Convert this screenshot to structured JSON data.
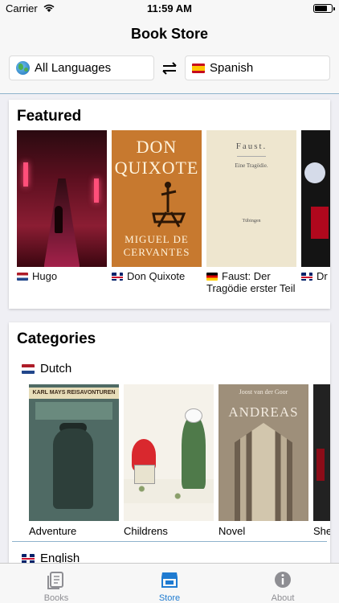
{
  "status_bar": {
    "carrier": "Carrier",
    "time": "11:59 AM",
    "battery_level": 0.75
  },
  "nav": {
    "title": "Book Store"
  },
  "language_selector": {
    "from": {
      "label": "All Languages",
      "icon": "globe-icon"
    },
    "swap_icon": "swap-arrows-icon",
    "to": {
      "label": "Spanish",
      "flag": "spain-flag"
    }
  },
  "featured": {
    "title": "Featured",
    "books": [
      {
        "caption": "Hugo",
        "flag": "netherlands-flag"
      },
      {
        "caption": "Don Quixote",
        "flag": "uk-flag",
        "cover_title": "DON QUIXOTE",
        "cover_author": "MIGUEL DE CERVANTES"
      },
      {
        "caption": "Faust: Der Tragödie erster Teil",
        "flag": "germany-flag",
        "cover_title": "Faust.",
        "cover_line2": "Eine Tragödie.",
        "cover_line3": "Tübingen"
      },
      {
        "caption": "Dr",
        "flag": "uk-flag"
      }
    ]
  },
  "categories": {
    "title": "Categories",
    "groups": [
      {
        "language": "Dutch",
        "flag": "netherlands-flag",
        "items": [
          {
            "label": "Adventure",
            "cover_header": "KARL MAYS REISAVONTUREN"
          },
          {
            "label": "Childrens"
          },
          {
            "label": "Novel",
            "cover_author": "Joost van der Goor",
            "cover_title": "ANDREAS"
          },
          {
            "label": "She"
          }
        ]
      },
      {
        "language": "English",
        "flag": "uk-flag"
      }
    ]
  },
  "tabbar": {
    "tabs": [
      {
        "label": "Books",
        "icon": "books-icon",
        "active": false
      },
      {
        "label": "Store",
        "icon": "store-icon",
        "active": true
      },
      {
        "label": "About",
        "icon": "info-icon",
        "active": false
      }
    ],
    "active_color": "#1e7bd1",
    "inactive_color": "#8e8e93"
  }
}
